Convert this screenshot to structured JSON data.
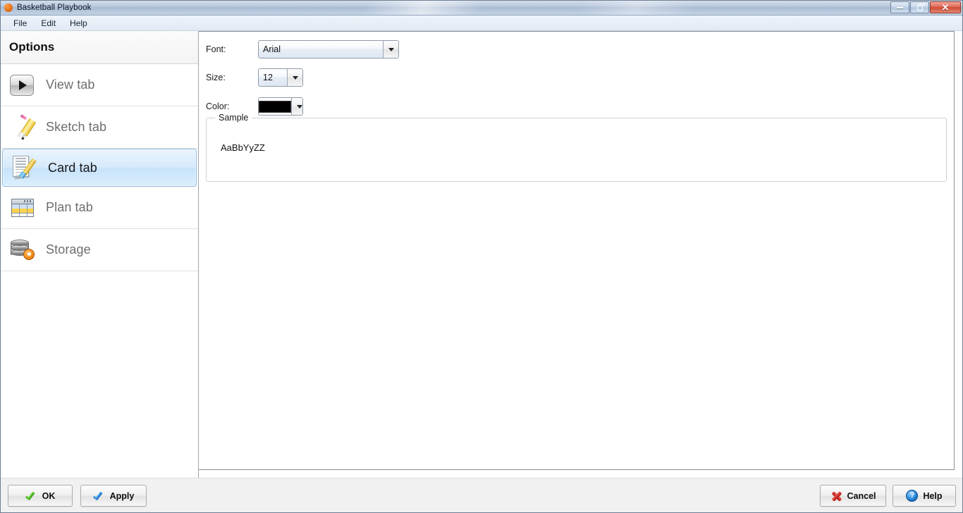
{
  "window": {
    "title": "Basketball Playbook",
    "app_icon": "basketball-icon",
    "caption": {
      "minimize": "minimize-icon",
      "restore": "restore-icon",
      "close": "close-icon",
      "close_glyph": "✕"
    }
  },
  "menubar": {
    "items": [
      {
        "label": "File"
      },
      {
        "label": "Edit"
      },
      {
        "label": "Help"
      }
    ]
  },
  "sidebar": {
    "header": "Options",
    "items": [
      {
        "label": "View tab",
        "icon": "play-icon",
        "selected": false
      },
      {
        "label": "Sketch tab",
        "icon": "pencil-icon",
        "selected": false
      },
      {
        "label": "Card tab",
        "icon": "card-pen-icon",
        "selected": true
      },
      {
        "label": "Plan tab",
        "icon": "grid-icon",
        "selected": false
      },
      {
        "label": "Storage",
        "icon": "database-gear-icon",
        "selected": false
      }
    ]
  },
  "main": {
    "fields": [
      {
        "label": "Font:",
        "value": "Arial"
      },
      {
        "label": "Size:",
        "value": "12"
      },
      {
        "label": "Color:",
        "value": "",
        "swatch": "#000000"
      }
    ],
    "sample_group": {
      "legend": "Sample",
      "text": "AaBbYyZZ"
    }
  },
  "footer": {
    "buttons": [
      {
        "label": "OK",
        "icon": "green-check-icon"
      },
      {
        "label": "Apply",
        "icon": "blue-check-icon"
      },
      {
        "label": "Cancel",
        "icon": "red-x-icon"
      },
      {
        "label": "Help",
        "icon": "blue-question-icon",
        "glyph": "?"
      }
    ]
  }
}
